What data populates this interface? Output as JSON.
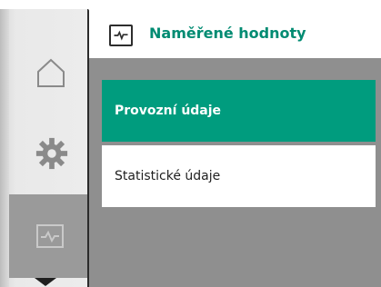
{
  "header": {
    "title": "Naměřené hodnoty",
    "icon": "chart-icon"
  },
  "menu": {
    "items": [
      {
        "label": "Provozní údaje",
        "selected": true
      },
      {
        "label": "Statistické údaje",
        "selected": false
      }
    ]
  },
  "rail": {
    "items": [
      {
        "icon": "home-icon"
      },
      {
        "icon": "gear-icon"
      },
      {
        "icon": "chart-icon",
        "active": true
      }
    ]
  },
  "colors": {
    "accent": "#009c7e",
    "title": "#008b72",
    "background": "#8f8f8f"
  }
}
